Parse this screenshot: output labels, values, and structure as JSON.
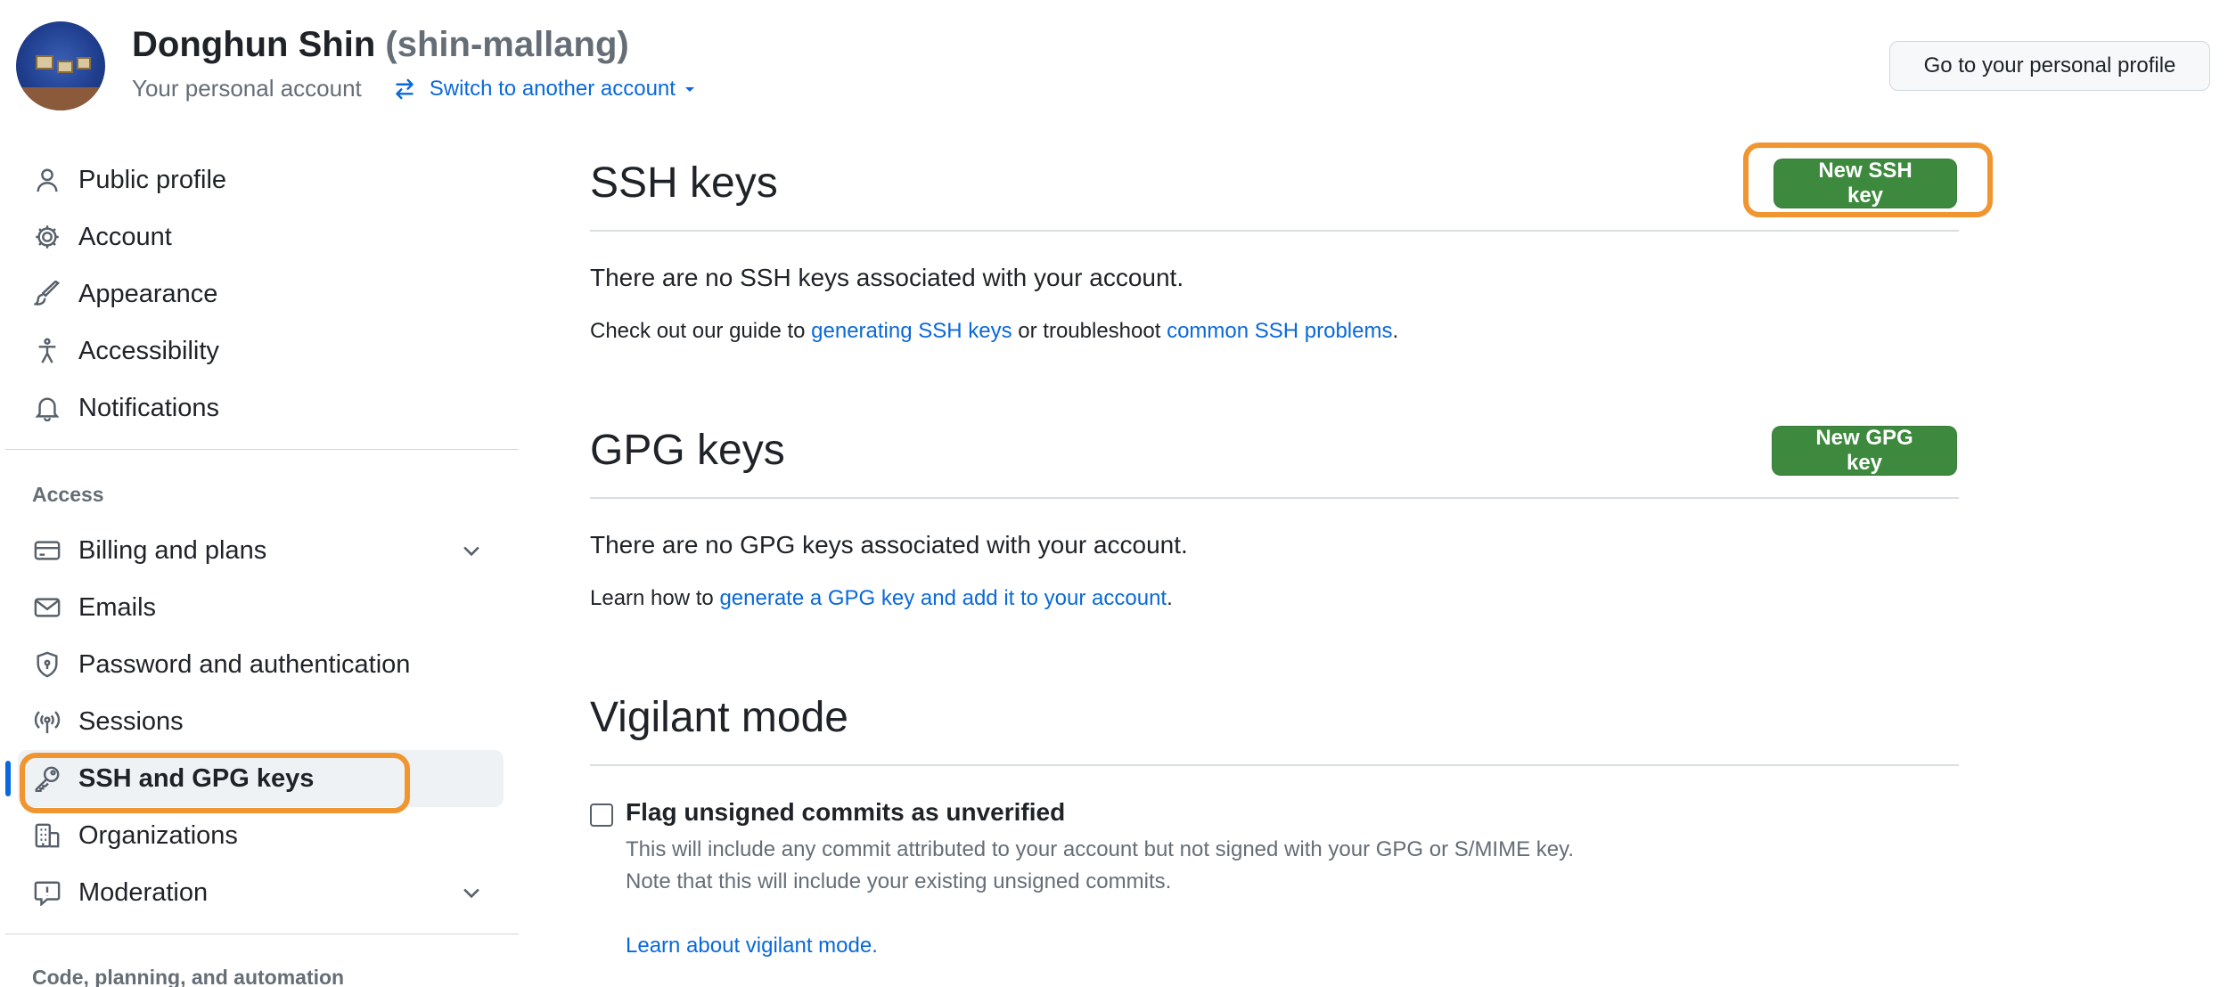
{
  "header": {
    "name": "Donghun Shin",
    "login": "(shin-mallang)",
    "subtitle": "Your personal account",
    "switch_label": "Switch to another account",
    "profile_button": "Go to your personal profile"
  },
  "sidebar": {
    "items": [
      {
        "label": "Public profile",
        "icon": "person-icon"
      },
      {
        "label": "Account",
        "icon": "gear-icon"
      },
      {
        "label": "Appearance",
        "icon": "paintbrush-icon"
      },
      {
        "label": "Accessibility",
        "icon": "accessibility-icon"
      },
      {
        "label": "Notifications",
        "icon": "bell-icon"
      }
    ],
    "access_label": "Access",
    "access_items": [
      {
        "label": "Billing and plans",
        "icon": "credit-card-icon",
        "expandable": true
      },
      {
        "label": "Emails",
        "icon": "mail-icon"
      },
      {
        "label": "Password and authentication",
        "icon": "shield-icon"
      },
      {
        "label": "Sessions",
        "icon": "broadcast-icon"
      },
      {
        "label": "SSH and GPG keys",
        "icon": "key-icon",
        "active": true
      },
      {
        "label": "Organizations",
        "icon": "organization-icon"
      },
      {
        "label": "Moderation",
        "icon": "report-icon",
        "expandable": true
      }
    ],
    "next_section_label": "Code, planning, and automation"
  },
  "ssh": {
    "title": "SSH keys",
    "button": "New SSH key",
    "empty": "There are no SSH keys associated with your account.",
    "guide_prefix": "Check out our guide to ",
    "guide_link": "generating SSH keys",
    "guide_middle": " or troubleshoot ",
    "guide_link2": "common SSH problems",
    "guide_suffix": "."
  },
  "gpg": {
    "title": "GPG keys",
    "button": "New GPG key",
    "empty": "There are no GPG keys associated with your account.",
    "learn_prefix": "Learn how to ",
    "learn_link": "generate a GPG key and add it to your account",
    "learn_suffix": "."
  },
  "vigilant": {
    "title": "Vigilant mode",
    "checkbox_label": "Flag unsigned commits as unverified",
    "checked": false,
    "desc1": "This will include any commit attributed to your account but not signed with your GPG or S/MIME key.",
    "desc2": "Note that this will include your existing unsigned commits.",
    "learn_link": "Learn about vigilant mode."
  },
  "colors": {
    "accent": "#0969da",
    "button_green": "#3d8a3e",
    "highlight": "#f0952f"
  }
}
